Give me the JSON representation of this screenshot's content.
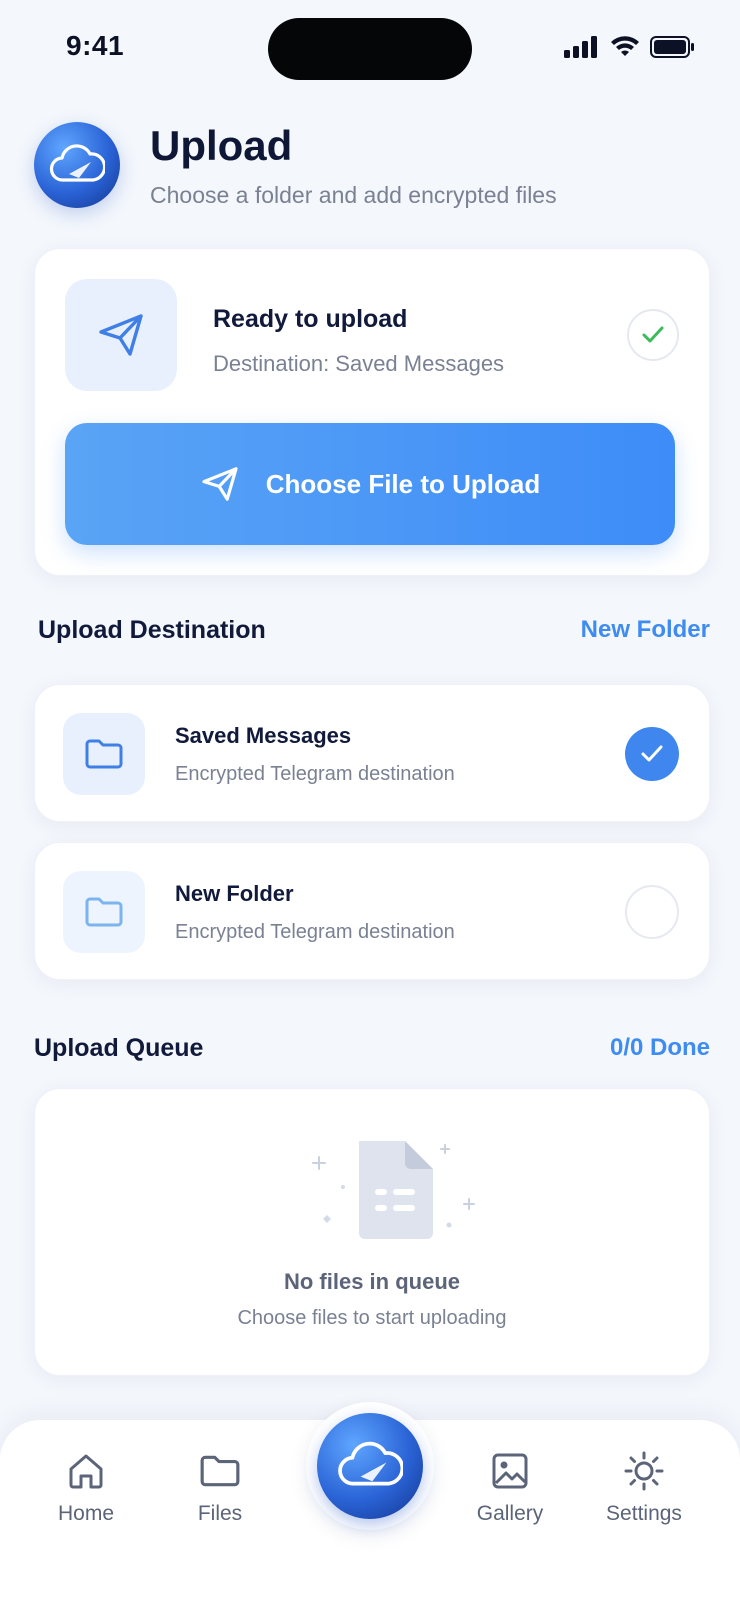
{
  "status_bar": {
    "time": "9:41"
  },
  "header": {
    "title": "Upload",
    "subtitle": "Choose a folder and add encrypted files"
  },
  "ready_card": {
    "title": "Ready to upload",
    "destination_text": "Destination: Saved Messages",
    "primary_button_label": "Choose File to Upload"
  },
  "destination_section": {
    "title": "Upload Destination",
    "action_label": "New Folder",
    "items": [
      {
        "name": "Saved Messages",
        "description": "Encrypted Telegram destination",
        "selected": true
      },
      {
        "name": "New Folder",
        "description": "Encrypted Telegram destination",
        "selected": false
      }
    ]
  },
  "queue_section": {
    "title": "Upload Queue",
    "status": "0/0 Done",
    "empty_title": "No files in queue",
    "empty_subtitle": "Choose files to start uploading"
  },
  "tabbar": {
    "items": [
      {
        "label": "Home",
        "icon": "home-icon"
      },
      {
        "label": "Files",
        "icon": "folder-icon"
      },
      {
        "label": "Gallery",
        "icon": "image-icon"
      },
      {
        "label": "Settings",
        "icon": "gear-icon"
      }
    ],
    "center_icon": "cloud-upload-icon"
  },
  "colors": {
    "accent": "#3f8cf0",
    "background": "#f4f7fc",
    "success": "#3dbb5a"
  }
}
